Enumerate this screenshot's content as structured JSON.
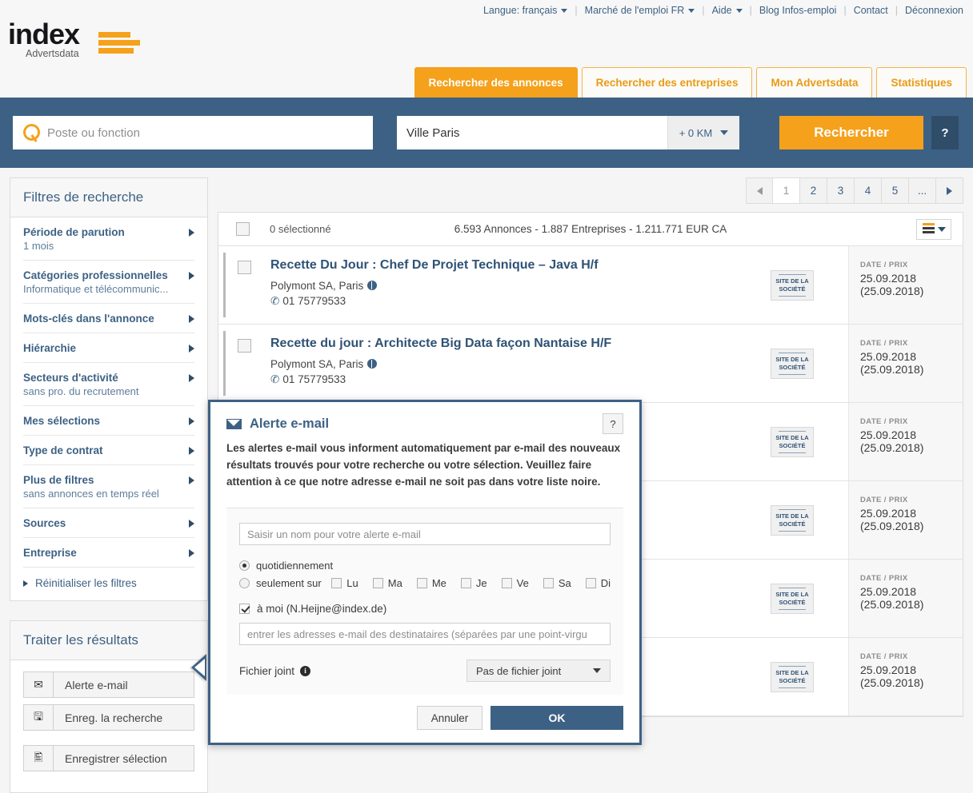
{
  "topbar": {
    "items": [
      {
        "label": "Langue: français",
        "caret": true
      },
      {
        "label": "Marché de l'emploi FR",
        "caret": true
      },
      {
        "label": "Aide",
        "caret": true
      },
      {
        "label": "Blog Infos-emploi",
        "caret": false
      },
      {
        "label": "Contact",
        "caret": false
      },
      {
        "label": "Déconnexion",
        "caret": false
      }
    ]
  },
  "brand": {
    "word": "index",
    "sub": "Advertsdata"
  },
  "tabs": [
    {
      "label": "Rechercher des annonces",
      "active": true
    },
    {
      "label": "Rechercher des entreprises",
      "active": false
    },
    {
      "label": "Mon Advertsdata",
      "active": false
    },
    {
      "label": "Statistiques",
      "active": false
    }
  ],
  "search": {
    "query_placeholder": "Poste ou fonction",
    "query_value": "",
    "city_value": "Ville Paris",
    "city_placeholder": "Ville",
    "radius": "+ 0 KM",
    "button": "Rechercher",
    "help": "?"
  },
  "sidebar": {
    "filters_title": "Filtres de recherche",
    "filters": [
      {
        "title": "Période de parution",
        "sub": "1 mois"
      },
      {
        "title": "Catégories professionnelles",
        "sub": "Informatique et télécommunic..."
      },
      {
        "title": "Mots-clés dans l'annonce",
        "sub": ""
      },
      {
        "title": "Hiérarchie",
        "sub": ""
      },
      {
        "title": "Secteurs d'activité",
        "sub": "sans pro. du recrutement"
      },
      {
        "title": "Mes sélections",
        "sub": ""
      },
      {
        "title": "Type de contrat",
        "sub": ""
      },
      {
        "title": "Plus de filtres",
        "sub": "sans annonces en temps réel"
      },
      {
        "title": "Sources",
        "sub": ""
      },
      {
        "title": "Entreprise",
        "sub": ""
      }
    ],
    "reset_label": "Réinitialiser les filtres",
    "results_title": "Traiter les résultats",
    "result_buttons": [
      {
        "label": "Alerte e-mail",
        "icon": "envelope-icon",
        "glyph": "✉"
      },
      {
        "label": "Enreg. la recherche",
        "icon": "save-icon",
        "glyph": "💾"
      },
      {
        "label": "Enregistrer sélection",
        "icon": "export-icon",
        "glyph": "🖫"
      }
    ]
  },
  "pagination": {
    "prev": "◄",
    "pages": [
      "1",
      "2",
      "3",
      "4",
      "5",
      "..."
    ],
    "current": "1",
    "next": "►"
  },
  "results_header": {
    "selected": "0 sélectionné",
    "stats": "6.593 Annonces  -  1.887 Entreprises  -  1.211.771 EUR CA",
    "sort_icon": "sort-menu-icon"
  },
  "results": [
    {
      "title": "Recette Du Jour : Chef De Projet Technique – Java H/f",
      "company": "Polymont SA, Paris",
      "phone": "01 75779533",
      "badge_line1": "SITE DE LA",
      "badge_line2": "SOCIÉTÉ",
      "date_label": "DATE / PRIX",
      "date1": "25.09.2018",
      "date2": "(25.09.2018)"
    },
    {
      "title": "Recette du jour : Architecte Big Data façon Nantaise H/F",
      "company": "Polymont SA, Paris",
      "phone": "01 75779533",
      "badge_line1": "SITE DE LA",
      "badge_line2": "SOCIÉTÉ",
      "date_label": "DATE / PRIX",
      "date1": "25.09.2018",
      "date2": "(25.09.2018)"
    },
    {
      "title": "",
      "company": "",
      "phone": "",
      "badge_line1": "SITE DE LA",
      "badge_line2": "SOCIÉTÉ",
      "date_label": "DATE / PRIX",
      "date1": "25.09.2018",
      "date2": "(25.09.2018)"
    },
    {
      "title": "",
      "company": "",
      "phone": "",
      "badge_line1": "SITE DE LA",
      "badge_line2": "SOCIÉTÉ",
      "date_label": "DATE / PRIX",
      "date1": "25.09.2018",
      "date2": "(25.09.2018)"
    },
    {
      "title": "",
      "company": "",
      "phone": "",
      "badge_line1": "SITE DE LA",
      "badge_line2": "SOCIÉTÉ",
      "date_label": "DATE / PRIX",
      "date1": "25.09.2018",
      "date2": "(25.09.2018)"
    },
    {
      "title": "",
      "company": "",
      "phone": "",
      "badge_line1": "SITE DE LA",
      "badge_line2": "SOCIÉTÉ",
      "date_label": "DATE / PRIX",
      "date1": "25.09.2018",
      "date2": "(25.09.2018)"
    }
  ],
  "modal": {
    "title": "Alerte e-mail",
    "help": "?",
    "description": "Les alertes e-mail vous informent automatiquement par e-mail des nouveaux résultats trouvés pour votre recherche ou votre sélection. Veuillez faire attention à ce que notre adresse e-mail ne soit pas dans votre liste noire.",
    "name_placeholder": "Saisir un nom pour votre alerte e-mail",
    "name_value": "",
    "freq_daily": "quotidiennement",
    "freq_only_on": "seulement sur",
    "days": [
      "Lu",
      "Ma",
      "Me",
      "Je",
      "Ve",
      "Sa",
      "Di"
    ],
    "to_me": "à moi (N.Heijne@index.de)",
    "recipients_placeholder": "entrer les adresses e-mail des destinataires (séparées par une point-virgu",
    "recipients_value": "",
    "attachment_label": "Fichier joint",
    "attachment_value": "Pas de fichier joint",
    "cancel": "Annuler",
    "ok": "OK"
  },
  "colors": {
    "brand_orange": "#f5a11b",
    "brand_blue": "#3d6184",
    "dark_blue": "#2f4d69",
    "page_bg": "#f5f5f5"
  }
}
